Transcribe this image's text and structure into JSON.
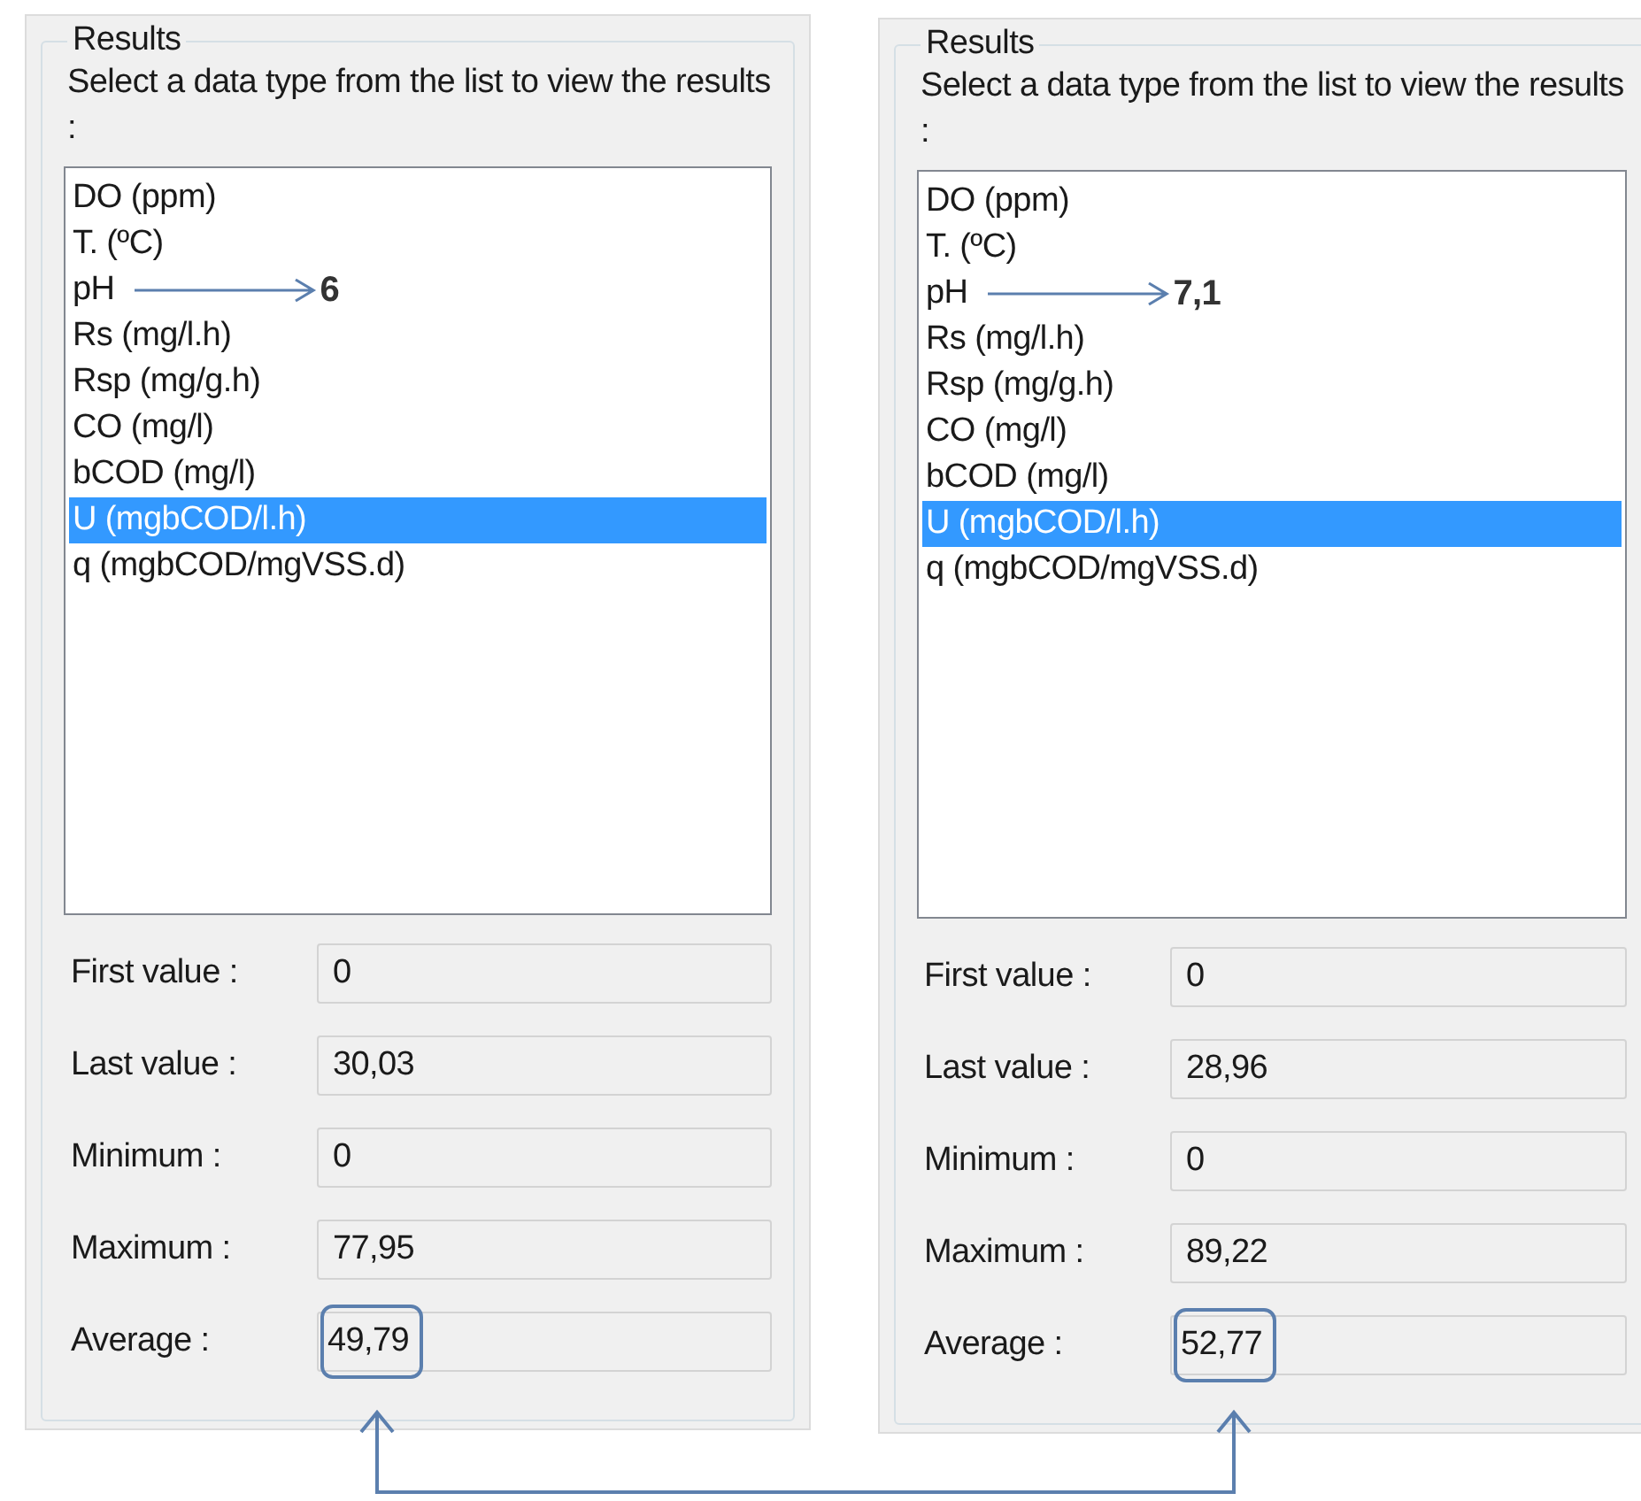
{
  "panels": [
    {
      "group_title": "Results",
      "instruction": "Select a data type from the list to view the results :",
      "items": [
        {
          "label": "DO (ppm)",
          "selected": false
        },
        {
          "label": "T. (ºC)",
          "selected": false
        },
        {
          "label": "pH",
          "selected": false,
          "annotation": "6"
        },
        {
          "label": "Rs (mg/l.h)",
          "selected": false
        },
        {
          "label": "Rsp (mg/g.h)",
          "selected": false
        },
        {
          "label": "CO (mg/l)",
          "selected": false
        },
        {
          "label": "bCOD (mg/l)",
          "selected": false
        },
        {
          "label": "U (mgbCOD/l.h)",
          "selected": true
        },
        {
          "label": "q (mgbCOD/mgVSS.d)",
          "selected": false
        }
      ],
      "stats": [
        {
          "label": "First value :",
          "value": "0",
          "highlighted": false
        },
        {
          "label": "Last value :",
          "value": "30,03",
          "highlighted": false
        },
        {
          "label": "Minimum :",
          "value": "0",
          "highlighted": false
        },
        {
          "label": "Maximum :",
          "value": "77,95",
          "highlighted": false
        },
        {
          "label": "Average :",
          "value": "49,79",
          "highlighted": true
        }
      ]
    },
    {
      "group_title": "Results",
      "instruction": "Select a data type from the list to view the results :",
      "items": [
        {
          "label": "DO (ppm)",
          "selected": false
        },
        {
          "label": "T. (ºC)",
          "selected": false
        },
        {
          "label": "pH",
          "selected": false,
          "annotation": "7,1"
        },
        {
          "label": "Rs (mg/l.h)",
          "selected": false
        },
        {
          "label": "Rsp (mg/g.h)",
          "selected": false
        },
        {
          "label": "CO (mg/l)",
          "selected": false
        },
        {
          "label": "bCOD (mg/l)",
          "selected": false
        },
        {
          "label": "U (mgbCOD/l.h)",
          "selected": true
        },
        {
          "label": "q (mgbCOD/mgVSS.d)",
          "selected": false
        }
      ],
      "stats": [
        {
          "label": "First value :",
          "value": "0",
          "highlighted": false
        },
        {
          "label": "Last value :",
          "value": "28,96",
          "highlighted": false
        },
        {
          "label": "Minimum :",
          "value": "0",
          "highlighted": false
        },
        {
          "label": "Maximum :",
          "value": "89,22",
          "highlighted": false
        },
        {
          "label": "Average :",
          "value": "52,77",
          "highlighted": true
        }
      ]
    }
  ]
}
